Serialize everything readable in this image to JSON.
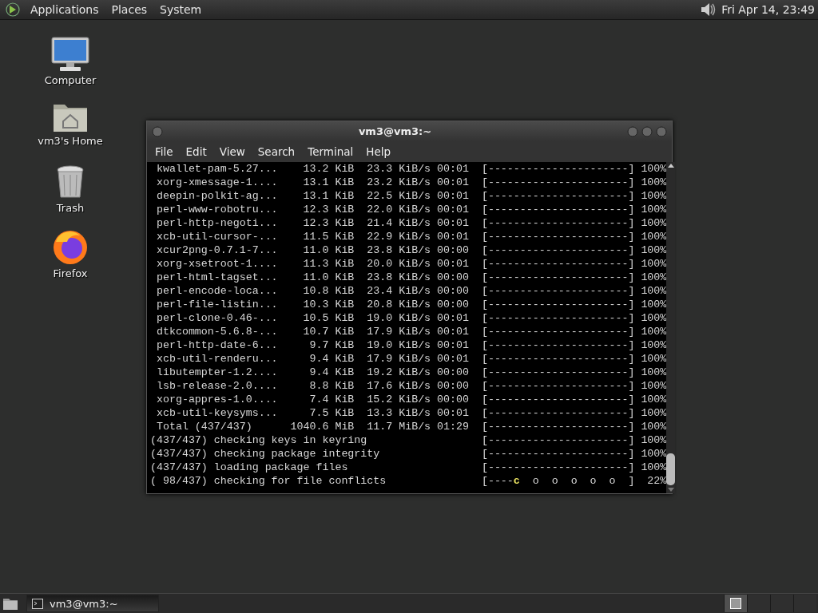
{
  "top_panel": {
    "menus": [
      "Applications",
      "Places",
      "System"
    ],
    "clock": "Fri Apr 14, 23:49"
  },
  "desktop_icons": [
    {
      "kind": "computer",
      "label": "Computer"
    },
    {
      "kind": "home",
      "label": "vm3's Home"
    },
    {
      "kind": "trash",
      "label": "Trash"
    },
    {
      "kind": "browser",
      "label": "Firefox"
    }
  ],
  "window": {
    "title": "vm3@vm3:~",
    "menu": [
      "File",
      "Edit",
      "View",
      "Search",
      "Terminal",
      "Help"
    ],
    "lines": [
      {
        "text": " kwallet-pam-5.27...    13.2 KiB  23.3 KiB/s 00:01",
        "bar": "[----------------------]",
        "percent": "100%"
      },
      {
        "text": " xorg-xmessage-1....    13.1 KiB  23.2 KiB/s 00:01",
        "bar": "[----------------------]",
        "percent": "100%"
      },
      {
        "text": " deepin-polkit-ag...    13.1 KiB  22.5 KiB/s 00:01",
        "bar": "[----------------------]",
        "percent": "100%"
      },
      {
        "text": " perl-www-robotru...    12.3 KiB  22.0 KiB/s 00:01",
        "bar": "[----------------------]",
        "percent": "100%"
      },
      {
        "text": " perl-http-negoti...    12.3 KiB  21.4 KiB/s 00:01",
        "bar": "[----------------------]",
        "percent": "100%"
      },
      {
        "text": " xcb-util-cursor-...    11.5 KiB  22.9 KiB/s 00:01",
        "bar": "[----------------------]",
        "percent": "100%"
      },
      {
        "text": " xcur2png-0.7.1-7...    11.0 KiB  23.8 KiB/s 00:00",
        "bar": "[----------------------]",
        "percent": "100%"
      },
      {
        "text": " xorg-xsetroot-1....    11.3 KiB  20.0 KiB/s 00:01",
        "bar": "[----------------------]",
        "percent": "100%"
      },
      {
        "text": " perl-html-tagset...    11.0 KiB  23.8 KiB/s 00:00",
        "bar": "[----------------------]",
        "percent": "100%"
      },
      {
        "text": " perl-encode-loca...    10.8 KiB  23.4 KiB/s 00:00",
        "bar": "[----------------------]",
        "percent": "100%"
      },
      {
        "text": " perl-file-listin...    10.3 KiB  20.8 KiB/s 00:00",
        "bar": "[----------------------]",
        "percent": "100%"
      },
      {
        "text": " perl-clone-0.46-...    10.5 KiB  19.0 KiB/s 00:01",
        "bar": "[----------------------]",
        "percent": "100%"
      },
      {
        "text": " dtkcommon-5.6.8-...    10.7 KiB  17.9 KiB/s 00:01",
        "bar": "[----------------------]",
        "percent": "100%"
      },
      {
        "text": " perl-http-date-6...     9.7 KiB  19.0 KiB/s 00:01",
        "bar": "[----------------------]",
        "percent": "100%"
      },
      {
        "text": " xcb-util-renderu...     9.4 KiB  17.9 KiB/s 00:01",
        "bar": "[----------------------]",
        "percent": "100%"
      },
      {
        "text": " libutempter-1.2....     9.4 KiB  19.2 KiB/s 00:00",
        "bar": "[----------------------]",
        "percent": "100%"
      },
      {
        "text": " lsb-release-2.0....     8.8 KiB  17.6 KiB/s 00:00",
        "bar": "[----------------------]",
        "percent": "100%"
      },
      {
        "text": " xorg-appres-1.0....     7.4 KiB  15.2 KiB/s 00:00",
        "bar": "[----------------------]",
        "percent": "100%"
      },
      {
        "text": " xcb-util-keysyms...     7.5 KiB  13.3 KiB/s 00:01",
        "bar": "[----------------------]",
        "percent": "100%"
      },
      {
        "text": " Total (437/437)      1040.6 MiB  11.7 MiB/s 01:29",
        "bar": "[----------------------]",
        "percent": "100%"
      },
      {
        "text": "(437/437) checking keys in keyring",
        "bar": "[----------------------]",
        "percent": "100%"
      },
      {
        "text": "(437/437) checking package integrity",
        "bar": "[----------------------]",
        "percent": "100%"
      },
      {
        "text": "(437/437) loading package files",
        "bar": "[----------------------]",
        "percent": "100%"
      },
      {
        "text": "( 98/437) checking for file conflicts",
        "bar": "[----",
        "pacman": "c",
        "bar_rest": "  o  o  o  o  o  ]",
        "percent": "22%"
      }
    ]
  },
  "taskbar": {
    "tasks": [
      {
        "label": "vm3@vm3:~",
        "selected": true
      }
    ],
    "workspaces": [
      {
        "selected": true
      },
      {
        "selected": false
      },
      {
        "selected": false
      },
      {
        "selected": false
      }
    ]
  }
}
